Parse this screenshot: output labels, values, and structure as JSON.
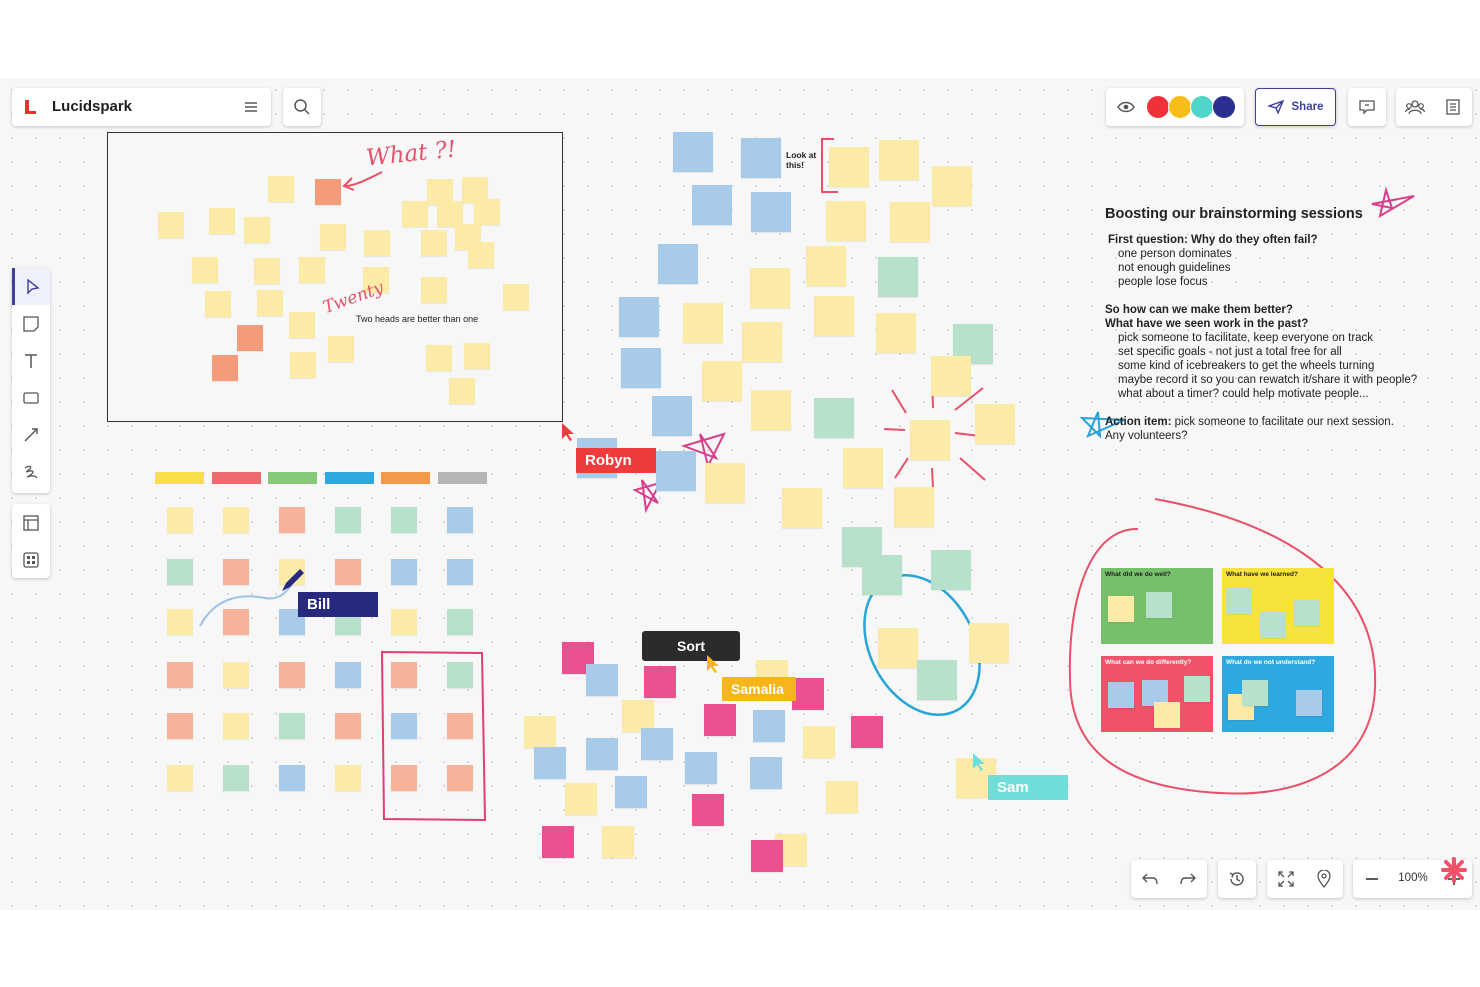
{
  "app": {
    "name": "Lucidspark",
    "brand_color": "#e8322b"
  },
  "toolbar": {
    "share_label": "Share",
    "zoom": "100%"
  },
  "collaborator_colors": [
    "#f0313a",
    "#f8bd19",
    "#4fd6c9",
    "#2c2f8f"
  ],
  "frame": {
    "annotation_what": "What ?!",
    "annotation_twenty": "Twenty",
    "caption": "Two heads are better than one"
  },
  "look_note": "Look at this!",
  "cursors": {
    "robyn": {
      "name": "Robyn",
      "color": "#ef3b3b"
    },
    "bill": {
      "name": "Bill",
      "color": "#27297f"
    },
    "samalia": {
      "name": "Samalia",
      "color": "#f6b51b"
    },
    "sam": {
      "name": "Sam",
      "color": "#6fded8"
    }
  },
  "sort_tooltip": "Sort",
  "notes_doc": {
    "title": "Boosting our brainstorming sessions",
    "q1": "First question: Why do they often fail?",
    "q1_items": [
      "one person dominates",
      "not enough guidelines",
      "people lose focus"
    ],
    "q2a": "So how can we make them better?",
    "q2b": "What have we seen work in the past?",
    "q2_items": [
      "pick someone to facilitate, keep everyone on track",
      "set specific goals - not just a total free for all",
      "some kind of icebreakers to get the wheels turning",
      "maybe record it so you can rewatch it/share it with people?",
      "what about a timer? could help motivate people..."
    ],
    "action_label": "Action item:",
    "action_text": " pick someone to facilitate our next session.",
    "action_text2": "Any volunteers?"
  },
  "retro": {
    "q1": "What did we do well?",
    "q2": "What have we learned?",
    "q3": "What can we do differently?",
    "q4": "What do we not understand?"
  },
  "icons": [
    "lucid-logo-icon",
    "menu-icon",
    "search-icon",
    "eye-icon",
    "share-send-icon",
    "comment-icon",
    "collaborators-icon",
    "notes-panel-icon",
    "select-icon",
    "sticky-note-icon",
    "text-icon",
    "shape-icon",
    "line-icon",
    "draw-icon",
    "frame-icon",
    "templates-icon",
    "undo-icon",
    "redo-icon",
    "history-icon",
    "fit-screen-icon",
    "location-icon",
    "zoom-out-icon",
    "zoom-in-icon"
  ]
}
